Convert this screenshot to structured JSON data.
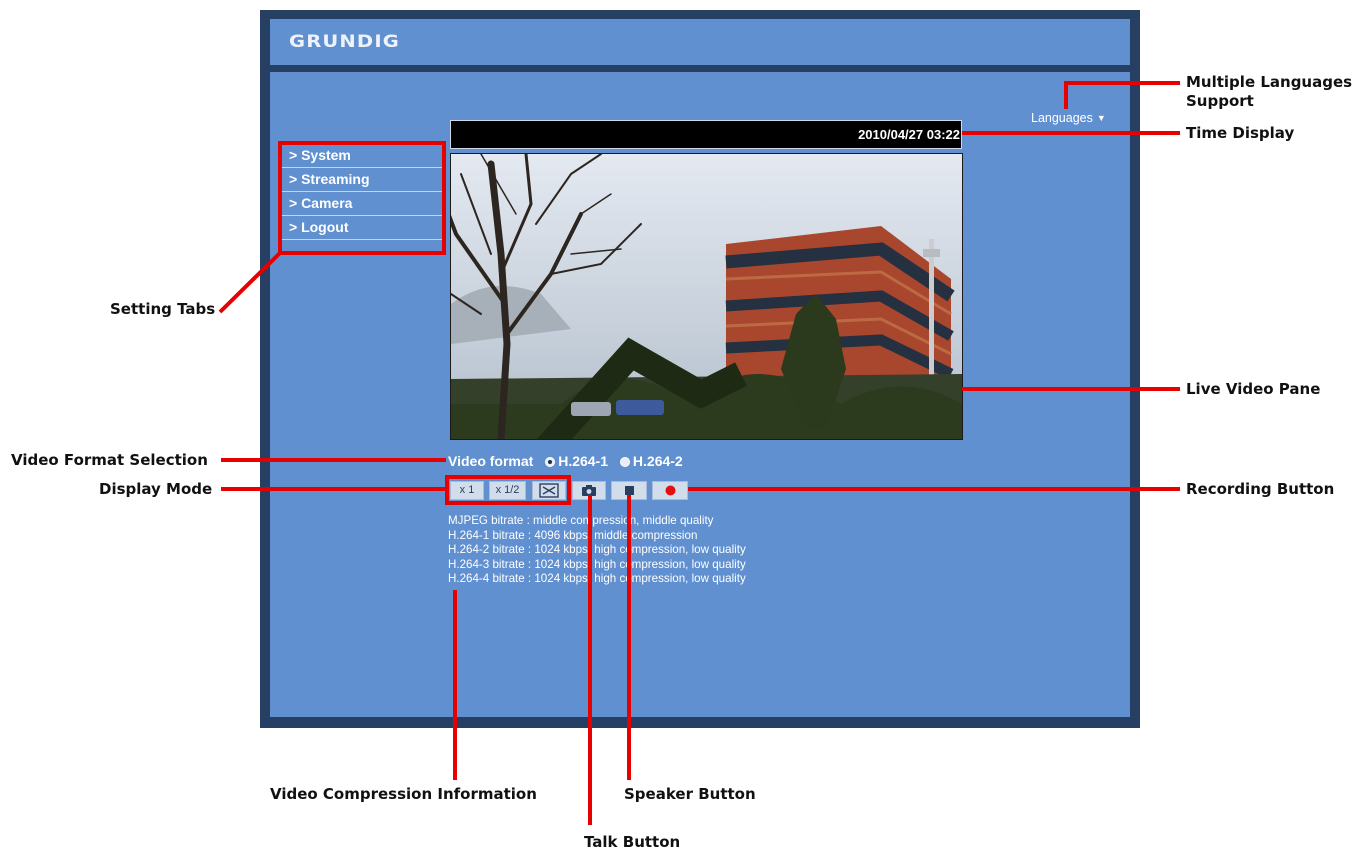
{
  "brand": "GRUNDIG",
  "languages_label": "Languages",
  "timestamp": "2010/04/27 03:22",
  "tabs": [
    {
      "label": "> System"
    },
    {
      "label": "> Streaming"
    },
    {
      "label": "> Camera"
    },
    {
      "label": "> Logout"
    }
  ],
  "video_format": {
    "label": "Video format",
    "options": [
      {
        "label": "H.264-1",
        "selected": true
      },
      {
        "label": "H.264-2",
        "selected": false
      }
    ]
  },
  "display_buttons": {
    "x1": "x 1",
    "x_half": "x 1/2"
  },
  "compression_info": [
    "MJPEG bitrate : middle compression, middle quality",
    "H.264-1 bitrate : 4096 kbps, middle compression",
    "H.264-2 bitrate : 1024 kbps, high compression, low quality",
    "H.264-3 bitrate : 1024 kbps, high compression, low quality",
    "H.264-4 bitrate : 1024 kbps, high compression, low quality"
  ],
  "callouts": {
    "languages": "Multiple Languages Support",
    "time": "Time Display",
    "setting_tabs": "Setting Tabs",
    "live_video": "Live Video Pane",
    "video_format": "Video Format Selection",
    "display_mode": "Display Mode",
    "recording": "Recording Button",
    "compression": "Video Compression Information",
    "speaker": "Speaker Button",
    "talk": "Talk Button"
  },
  "colors": {
    "frame": "#263f63",
    "panel": "#6090d0",
    "annotation": "#e60000"
  },
  "icons": [
    "snapshot-camera-icon",
    "stop-square-icon",
    "record-dot-icon",
    "fullscreen-icon",
    "dropdown-arrow-icon"
  ]
}
